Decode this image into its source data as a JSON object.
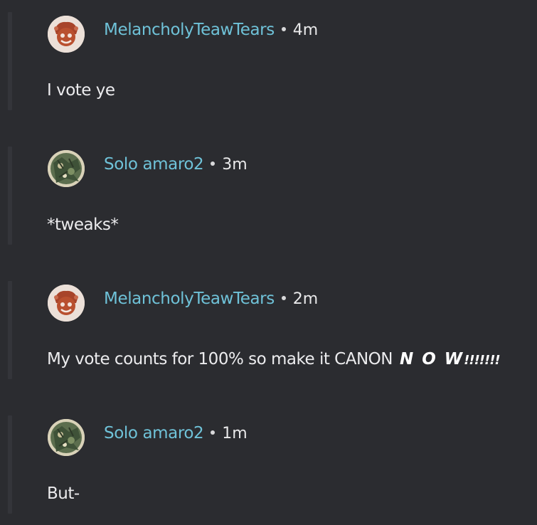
{
  "comments": [
    {
      "author": "MelancholyTeawTears",
      "time": "4m",
      "text": "I vote ye",
      "avatar_icon": "cartoon-face-avatar"
    },
    {
      "author": "Solo amaro2",
      "time": "3m",
      "text": "*tweaks*",
      "avatar_icon": "green-pattern-avatar"
    },
    {
      "author": "MelancholyTeawTears",
      "time": "2m",
      "text": "My vote counts for 100% so make it CANON",
      "emphasis": "N O W",
      "emphasis_suffix": "!!!!!!!",
      "avatar_icon": "cartoon-face-avatar"
    },
    {
      "author": "Solo amaro2",
      "time": "1m",
      "text": "But-",
      "avatar_icon": "green-pattern-avatar"
    }
  ],
  "colors": {
    "background": "#2b2c30",
    "author_link": "#6fc2d8",
    "body_text": "#ececee",
    "thread_line": "#34353a"
  }
}
